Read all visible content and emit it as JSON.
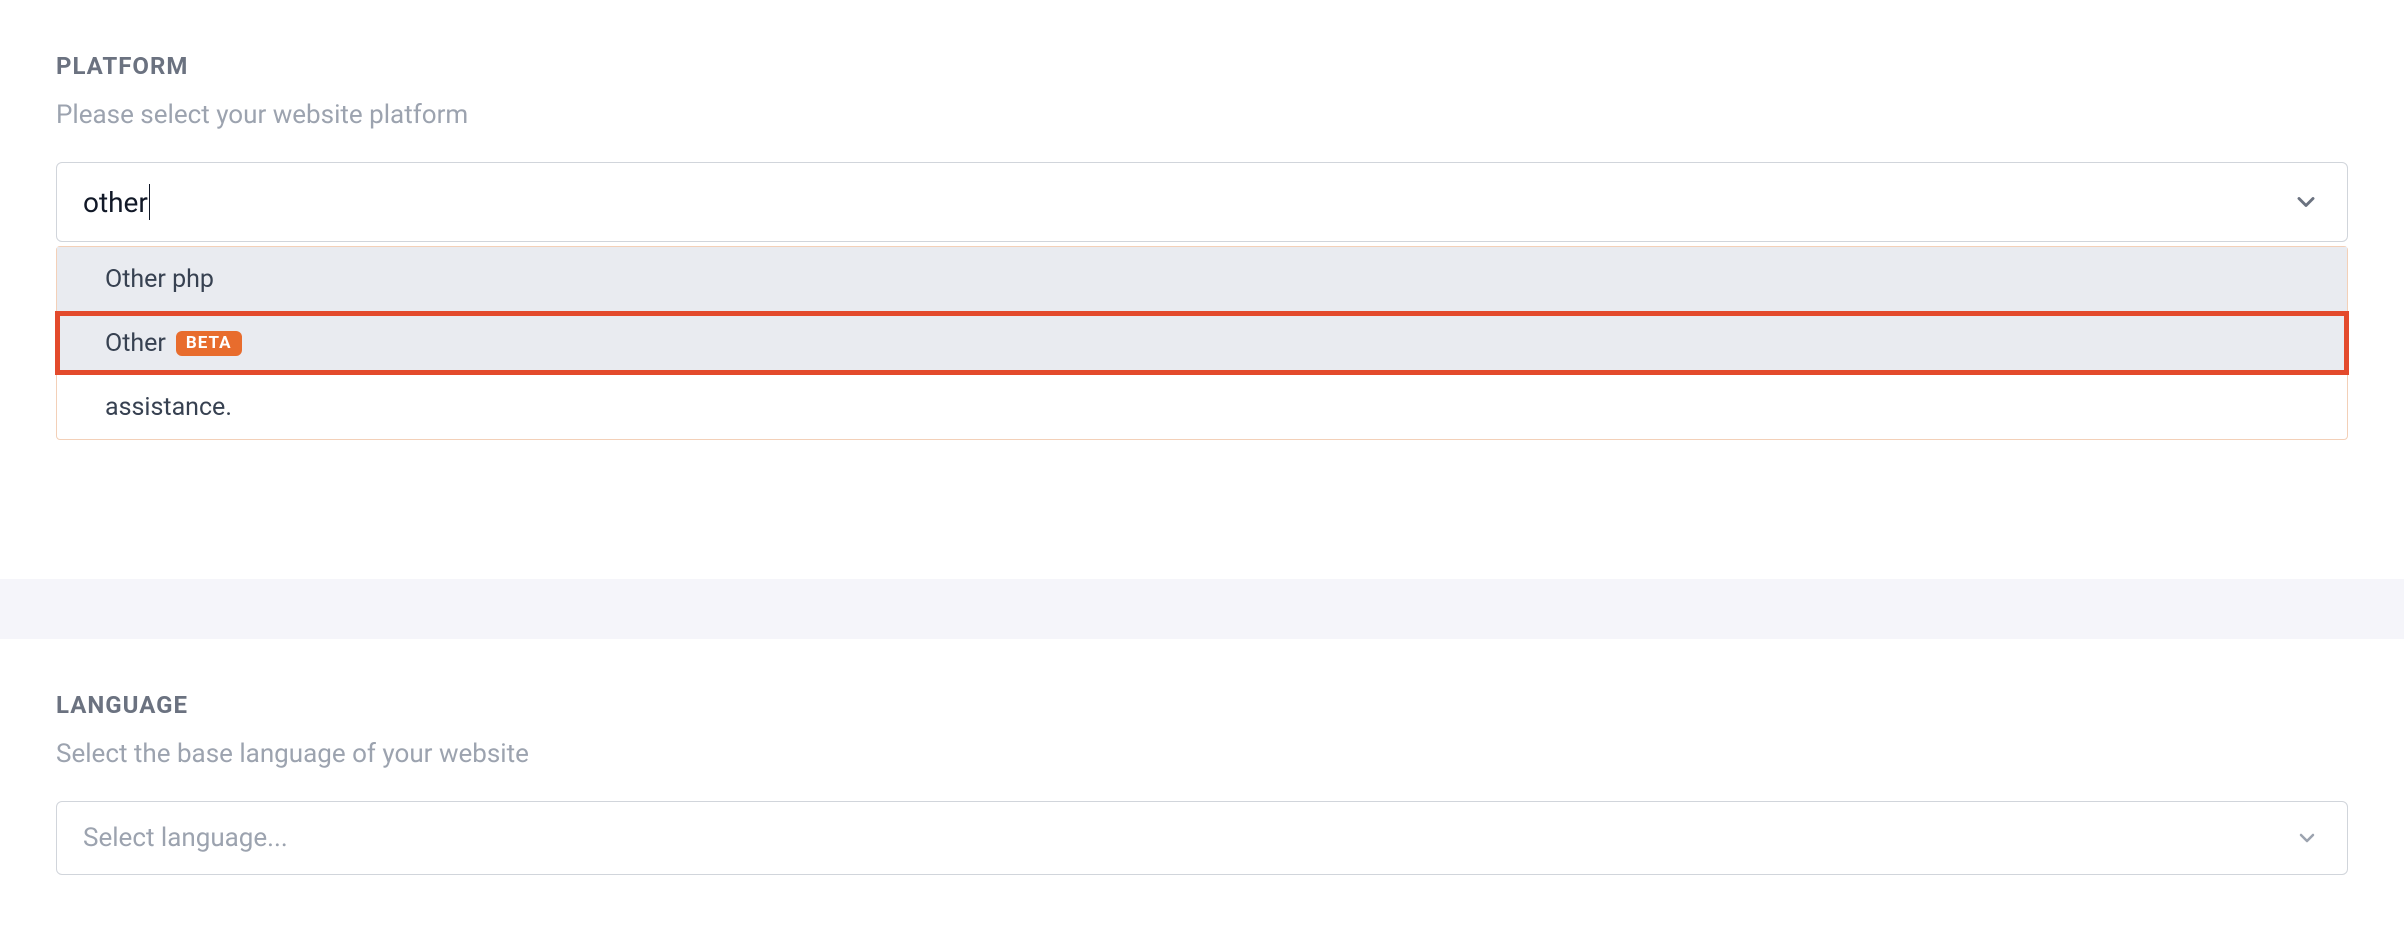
{
  "platform": {
    "title": "PLATFORM",
    "subtitle": "Please select your website platform",
    "typed_value": "other",
    "options": [
      {
        "label": "Other php",
        "badge": null,
        "hovered": true,
        "highlighted": false
      },
      {
        "label": "Other",
        "badge": "BETA",
        "hovered": false,
        "highlighted": true
      }
    ],
    "extra_text": "assistance."
  },
  "language": {
    "title": "LANGUAGE",
    "subtitle": "Select the base language of your website",
    "placeholder": "Select language..."
  }
}
